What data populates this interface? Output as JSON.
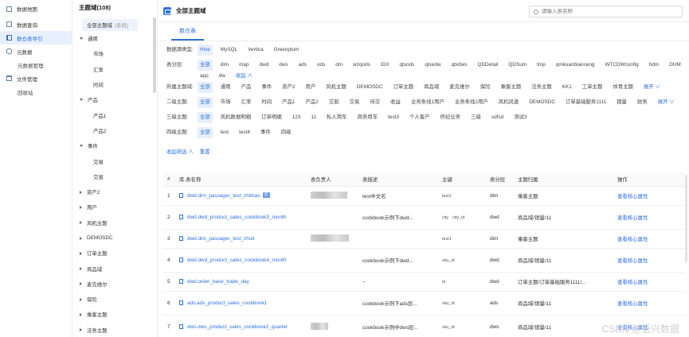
{
  "nav": {
    "items": [
      {
        "label": "数据地图",
        "icon": "box-icon",
        "active": false,
        "sub": false
      },
      {
        "label": "数据查询",
        "icon": "box-icon",
        "active": false,
        "sub": false
      },
      {
        "label": "数仓表导引",
        "icon": "book-icon",
        "active": true,
        "sub": false
      },
      {
        "label": "元数据",
        "icon": "database-icon",
        "active": false,
        "sub": false
      },
      {
        "label": "元数据管理",
        "icon": "",
        "active": false,
        "sub": true
      },
      {
        "label": "文件管理",
        "icon": "folder-icon",
        "active": false,
        "sub": false
      },
      {
        "label": "回收站",
        "icon": "",
        "active": false,
        "sub": true
      }
    ]
  },
  "tree": {
    "title": "主题域(108)",
    "all_label": "全部主题域",
    "all_sub": "(系统)",
    "items": [
      {
        "label": "通用",
        "level": 0,
        "expanded": true
      },
      {
        "label": "市场",
        "level": 1
      },
      {
        "label": "汇率",
        "level": 1
      },
      {
        "label": "时间",
        "level": 1
      },
      {
        "label": "产品",
        "level": 0,
        "expanded": true
      },
      {
        "label": "产品1",
        "level": 1
      },
      {
        "label": "产品2",
        "level": 1
      },
      {
        "label": "事件",
        "level": 0,
        "expanded": true
      },
      {
        "label": "交易",
        "level": 1
      },
      {
        "label": "交易",
        "level": 1
      },
      {
        "label": "资产2",
        "level": 0,
        "expanded": false
      },
      {
        "label": "用户",
        "level": 0,
        "expanded": false
      },
      {
        "label": "风机主题",
        "level": 0,
        "expanded": false
      },
      {
        "label": "DEMOSDC",
        "level": 0,
        "expanded": false
      },
      {
        "label": "订单主题",
        "level": 0,
        "expanded": false
      },
      {
        "label": "商品域",
        "level": 0,
        "expanded": false
      },
      {
        "label": "麦克维尔",
        "level": 0,
        "expanded": false
      },
      {
        "label": "保险",
        "level": 0,
        "expanded": false
      },
      {
        "label": "乘客主题",
        "level": 0,
        "expanded": false
      },
      {
        "label": "法务主题",
        "level": 0,
        "expanded": false
      }
    ]
  },
  "header": {
    "title": "全部主题域",
    "search_placeholder": "请输入表名称"
  },
  "tabs": [
    {
      "label": "数仓表",
      "active": true
    }
  ],
  "filters": [
    {
      "label": "数据源类型:",
      "options": [
        "Hive",
        "MySQL",
        "Vertica",
        "Greenplum"
      ],
      "selected": 0
    },
    {
      "label": "表分层:",
      "options": [
        "全部",
        "dim",
        "map",
        "dwd",
        "dws",
        "ads",
        "ods",
        "dm",
        "wzqods",
        "IDX",
        "qtxods",
        "qtxedw",
        "qtxdws",
        "QDDetail",
        "QDSum",
        "tmp",
        "qmkuanbiaoceng",
        "WTCDWconfig",
        "hdm",
        "DUM",
        "app",
        "dw"
      ],
      "selected": 0,
      "toggle": "收起 ∧"
    },
    {
      "label": "所属主题域:",
      "options": [
        "全部",
        "通用",
        "产品",
        "事件",
        "资产2",
        "用户",
        "风机主题",
        "DEMOSDC",
        "订单主题",
        "商品域",
        "麦克维尔",
        "保险",
        "乘客主题",
        "法务主题",
        "KK1",
        "工单主题",
        "体育主题"
      ],
      "selected": 0,
      "toggle": "展开 ∨"
    },
    {
      "label": "二级主题:",
      "options": [
        "全部",
        "市场",
        "汇率",
        "时间",
        "产品1",
        "产品2",
        "交割",
        "交易",
        "待交",
        "收益",
        "业务条线1用户",
        "业务条线2用户",
        "风机风速",
        "DEMOSDC",
        "订单基础服务1111",
        "销量",
        "财务"
      ],
      "selected": 0,
      "toggle": "展开 ∨"
    },
    {
      "label": "三级主题:",
      "options": [
        "全部",
        "风机数据明细",
        "订单明细",
        "123",
        "11",
        "私人用车",
        "商务用车",
        "test3",
        "个人客户",
        "终纪业务",
        "三级",
        "sdfsd",
        "测试3"
      ],
      "selected": 0
    },
    {
      "label": "四级主题:",
      "options": [
        "全部",
        "test",
        "test4",
        "事件",
        "四级"
      ],
      "selected": 0
    }
  ],
  "filter_actions": {
    "collapse": "收起筛选 ∧",
    "reset": "重置"
  },
  "table": {
    "headers": [
      "#",
      "库.表名称",
      "表负责人",
      "表描述",
      "主键",
      "表分层",
      "主题归属",
      "操作"
    ],
    "rows": [
      {
        "idx": "1",
        "name": "dwd.dim_passager_test_zhib\\ao",
        "owner_blur": true,
        "desc": "test中文名",
        "keys": [
          "test1"
        ],
        "layer": "dim",
        "theme": "乘客主题",
        "action": "查看核心属性",
        "badge": "长"
      },
      {
        "idx": "2",
        "name": "dwd.dwd_product_sales_cookbook3_month",
        "owner_blur": false,
        "desc": "cookbook示例下dwd...",
        "keys": [
          "city",
          "city_id"
        ],
        "layer": "dwd",
        "theme": "商品域/销量/11",
        "action": "查看核心属性",
        "badge": ""
      },
      {
        "idx": "3",
        "name": "dwd.dim_passager_test_zhuti",
        "owner_blur": true,
        "desc": "",
        "keys": [
          "test1"
        ],
        "layer": "dim",
        "theme": "乘客主题",
        "action": "查看核心属性",
        "badge": ""
      },
      {
        "idx": "4",
        "name": "dwd.dwd_product_sales_cookbook4_month",
        "owner_blur": false,
        "desc": "cookbook示例下dwd...",
        "keys": [
          "sku_id"
        ],
        "layer": "dwd",
        "theme": "商品域/销量/11",
        "action": "查看核心属性",
        "badge": ""
      },
      {
        "idx": "5",
        "name": "dwd.order_base_trade_day",
        "owner_blur": false,
        "desc": "--",
        "keys": [
          "id"
        ],
        "layer": "dwd",
        "theme": "订单主题/订单基础服务1111/...",
        "action": "查看核心属性",
        "badge": ""
      },
      {
        "idx": "6",
        "name": "ads.ads_product_sales_cookbook1",
        "owner_blur": false,
        "desc": "cookbook示例下ads层...",
        "keys": [
          "sku_id"
        ],
        "layer": "ads",
        "theme": "商品域/销量/11",
        "action": "查看核心属性",
        "badge": ""
      },
      {
        "idx": "7",
        "name": "dws.dws_product_sales_cookbook2_quarter",
        "owner_blur": true,
        "desc": "cookbook示例中dws层...",
        "keys": [
          "sku_id"
        ],
        "layer": "dws",
        "theme": "商品域/销量/11",
        "action": "查看核心属性",
        "badge": ""
      }
    ]
  },
  "watermark": "CSDN @语兴数据"
}
